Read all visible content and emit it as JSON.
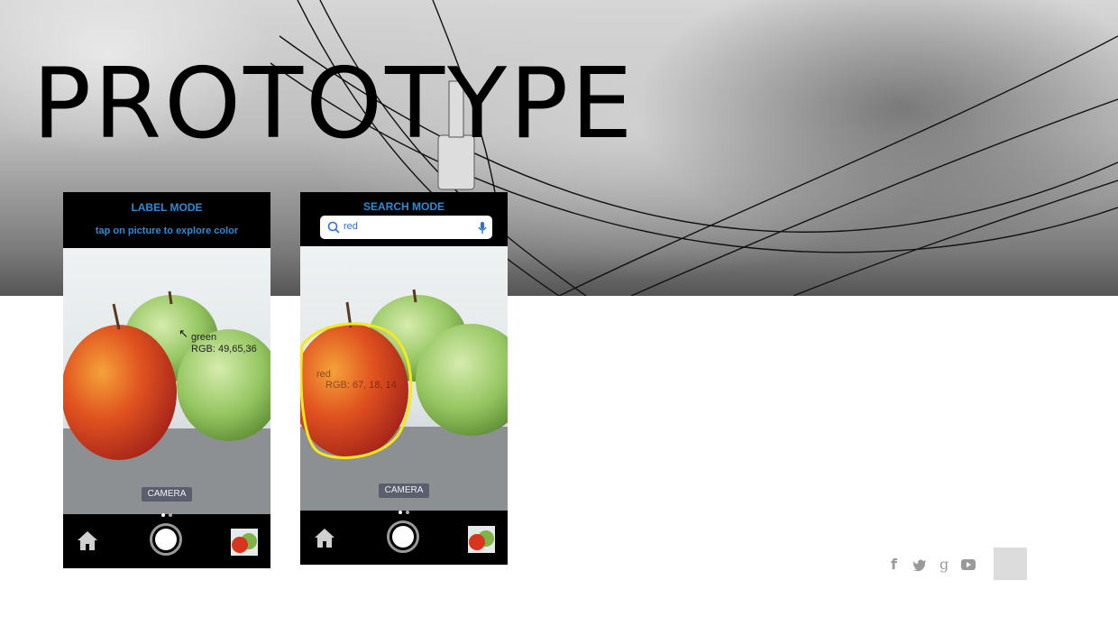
{
  "hero": {
    "title": "PROTOTYPE"
  },
  "label_phone": {
    "mode_title": "LABEL MODE",
    "hint": "tap on picture to explore color",
    "color_name": "green",
    "rgb_text": "RGB: 49,65,36",
    "camera_label": "CAMERA"
  },
  "search_phone": {
    "mode_title": "SEARCH MODE",
    "search_value": "red",
    "color_name": "red",
    "rgb_text": "RGB: 67, 18, 14",
    "camera_label": "CAMERA",
    "highlight_color": "#f4e81f"
  },
  "toolbar_icons": [
    "home-icon",
    "shutter-icon",
    "gallery-thumbnail"
  ],
  "social_icons": [
    "facebook-icon",
    "twitter-icon",
    "google-plus-icon",
    "youtube-icon"
  ],
  "colors": {
    "accent": "#2d8bd6",
    "apple_red": "#d9341f",
    "apple_green": "#8fc25a"
  }
}
